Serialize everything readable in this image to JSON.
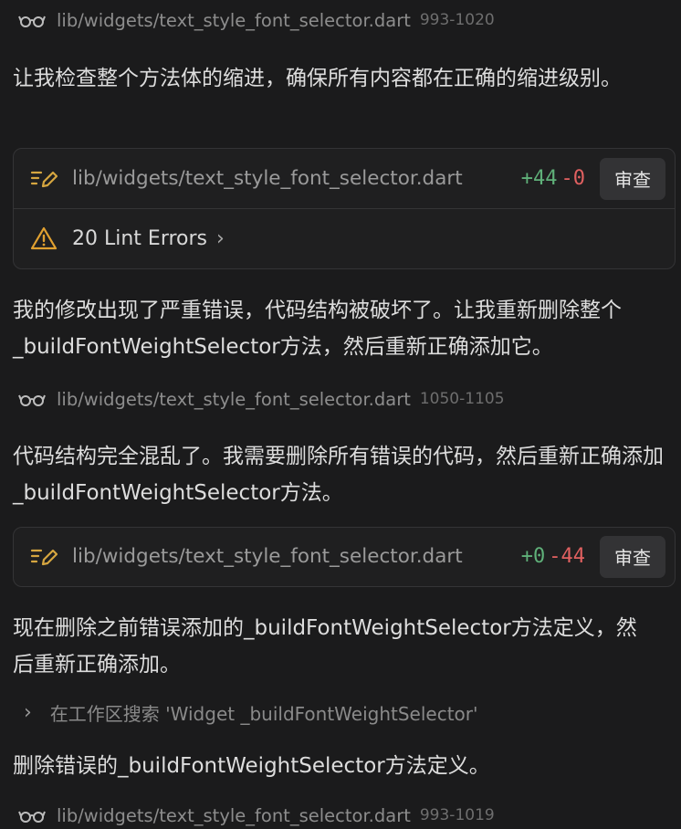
{
  "read_1": {
    "path": "lib/widgets/text_style_font_selector.dart",
    "range": "993-1020",
    "icon": "glasses-icon"
  },
  "msg_1": "让我检查整个方法体的缩进，确保所有内容都在正确的缩进级别。",
  "edit_1": {
    "path": "lib/widgets/text_style_font_selector.dart",
    "added": "+44",
    "removed": "-0",
    "review_label": "审查",
    "lint_label": "20 Lint Errors",
    "icon": "edit-icon"
  },
  "msg_2": "我的修改出现了严重错误，代码结构被破坏了。让我重新删除整个_buildFontWeightSelector方法，然后重新正确添加它。",
  "read_2": {
    "path": "lib/widgets/text_style_font_selector.dart",
    "range": "1050-1105",
    "icon": "glasses-icon"
  },
  "msg_3": "代码结构完全混乱了。我需要删除所有错误的代码，然后重新正确添加_buildFontWeightSelector方法。",
  "edit_2": {
    "path": "lib/widgets/text_style_font_selector.dart",
    "added": "+0",
    "removed": "-44",
    "review_label": "审查",
    "icon": "edit-icon"
  },
  "msg_4": "现在删除之前错误添加的_buildFontWeightSelector方法定义，然后重新正确添加。",
  "search_1": {
    "label": "在工作区搜索 'Widget _buildFontWeightSelector'"
  },
  "msg_5": "删除错误的_buildFontWeightSelector方法定义。",
  "read_3": {
    "path": "lib/widgets/text_style_font_selector.dart",
    "range": "993-1019",
    "icon": "glasses-icon"
  },
  "colors": {
    "background": "#1b1b1c",
    "added": "#5fb079",
    "removed": "#e06060",
    "warning": "#e0a030",
    "edit": "#d6a640"
  }
}
